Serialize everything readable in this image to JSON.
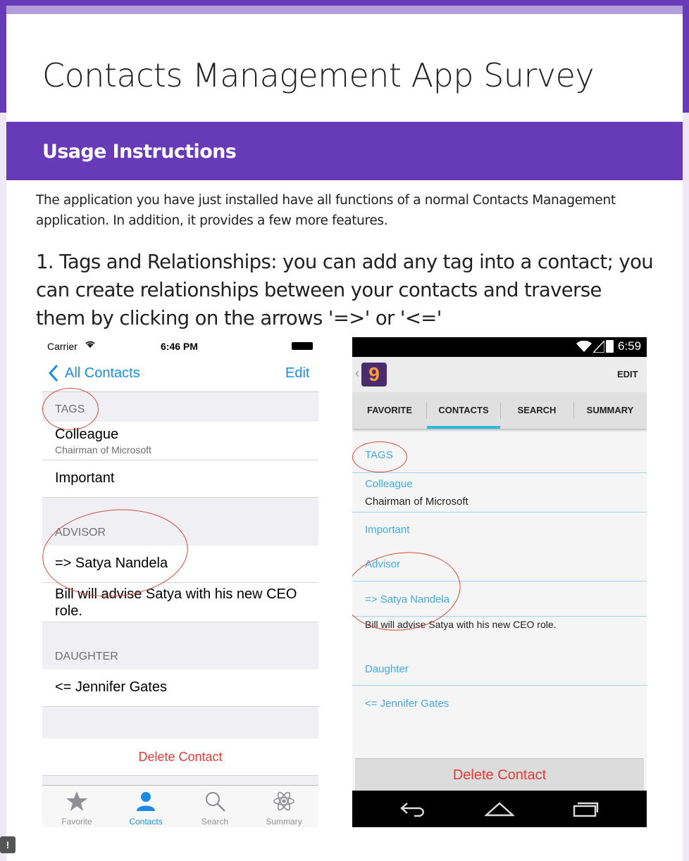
{
  "form": {
    "title": "Contacts Management App Survey"
  },
  "section": {
    "title": "Usage Instructions",
    "description": "The application you have just installed have all functions of a normal Contacts Management application. In addition, it provides a few more features.",
    "question": "1. Tags and Relationships: you can add any tag into a contact; you can create relationships between your contacts and traverse them by clicking on the arrows '=>' or '<='"
  },
  "ios": {
    "carrier": "Carrier",
    "time": "6:46 PM",
    "back_label": "All Contacts",
    "edit_label": "Edit",
    "tags_header": "TAGS",
    "tag1": "Colleague",
    "tag1_sub": "Chairman of Microsoft",
    "tag2": "Important",
    "advisor_header": "ADVISOR",
    "advisor_link": "=> Satya Nandela",
    "advisor_note": "Bill will advise Satya with his new CEO role.",
    "daughter_header": "DAUGHTER",
    "daughter_link": "<= Jennifer Gates",
    "delete_label": "Delete Contact",
    "tabs": [
      "Favorite",
      "Contacts",
      "Search",
      "Summary"
    ]
  },
  "android": {
    "time": "6:59",
    "app_icon_letter": "9",
    "edit_label": "EDIT",
    "tabs": [
      "FAVORITE",
      "CONTACTS",
      "SEARCH",
      "SUMMARY"
    ],
    "tags_label": "TAGS",
    "tag1": "Colleague",
    "tag1_sub": "Chairman of Microsoft",
    "tag2": "Important",
    "advisor_label": "Advisor",
    "advisor_link": "=> Satya Nandela",
    "advisor_note": "Bill will advise Satya with his new CEO role.",
    "daughter_label": "Daughter",
    "daughter_link": "<= Jennifer Gates",
    "delete_label": "Delete Contact"
  },
  "colors": {
    "theme": "#673ab7",
    "ios_blue": "#1a8ce6",
    "android_blue": "#3fa9e6",
    "delete_red": "#e53935",
    "annotation_red": "#d84a3a"
  }
}
